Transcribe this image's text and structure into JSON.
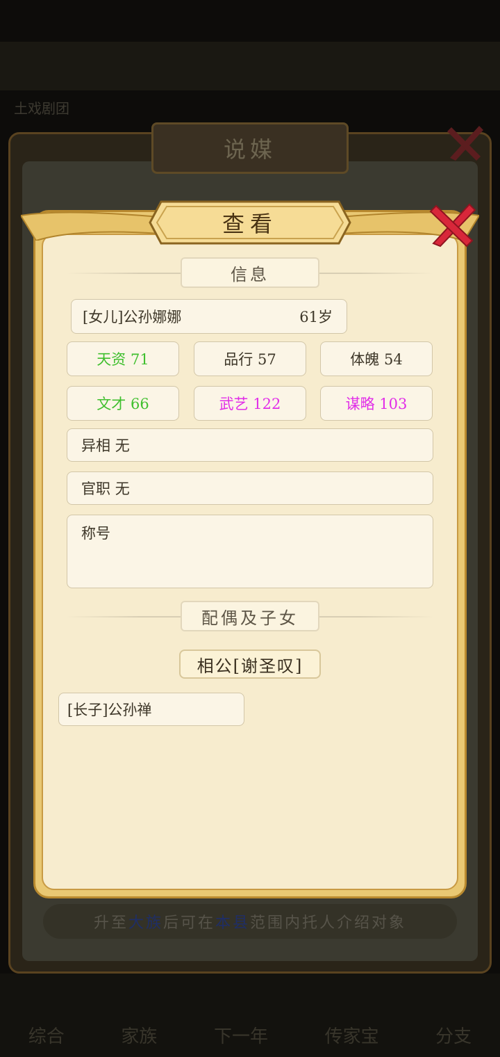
{
  "background": {
    "status_left": "土戏剧团",
    "tabs": [
      "综合",
      "家族",
      "下一年",
      "传家宝",
      "分支"
    ]
  },
  "outer_dialog": {
    "title": "说媒",
    "hint_prefix": "升至",
    "hint_highlight1": "大族",
    "hint_middle": "后可在",
    "hint_highlight2": "本县",
    "hint_suffix": "范围内托人介绍对象"
  },
  "view_dialog": {
    "title": "查看",
    "info_header": "信息",
    "person": {
      "name": "[女儿]公孙娜娜",
      "age": "61岁"
    },
    "stats": [
      {
        "label": "天资",
        "value": "71",
        "color": "#3fbf2e"
      },
      {
        "label": "品行",
        "value": "57",
        "color": "#3d3628"
      },
      {
        "label": "体魄",
        "value": "54",
        "color": "#3d3628"
      },
      {
        "label": "文才",
        "value": "66",
        "color": "#3fbf2e"
      },
      {
        "label": "武艺",
        "value": "122",
        "color": "#e12ee8"
      },
      {
        "label": "谋略",
        "value": "103",
        "color": "#e12ee8"
      }
    ],
    "trait_label": "异相",
    "trait_value": "无",
    "office_label": "官职",
    "office_value": "无",
    "title_label": "称号",
    "family_header": "配偶及子女",
    "spouse": "相公[谢圣叹]",
    "children": [
      "[长子]公孙禅"
    ]
  },
  "colors": {
    "gold": "#e9c873",
    "paper": "#f7ecce",
    "close_red": "#d8273a"
  }
}
